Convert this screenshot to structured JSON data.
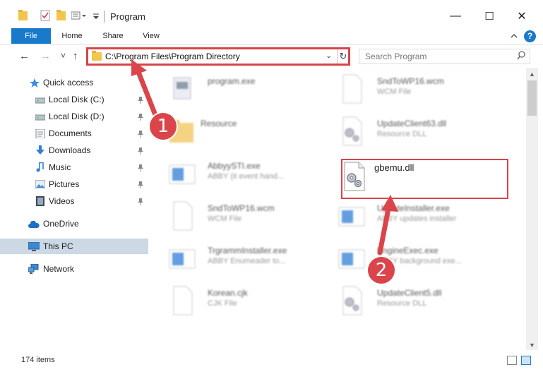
{
  "window": {
    "title": "Program",
    "minimize": "—",
    "maximize": "☐",
    "close": "✕"
  },
  "ribbon": {
    "tabs": [
      "File",
      "Home",
      "Share",
      "View"
    ],
    "help": "?"
  },
  "address": {
    "path": "C:\\Program Files\\Program Directory",
    "dropdown": "⌄",
    "refresh": "↻"
  },
  "search": {
    "placeholder": "Search Program",
    "icon": "search-icon"
  },
  "nav": {
    "back": "←",
    "forward": "→",
    "recent": "˅",
    "up": "↑",
    "items": [
      {
        "label": "Quick access",
        "icon": "star-icon",
        "pinned": false
      },
      {
        "label": "Local Disk (C:)",
        "icon": "drive-icon",
        "pinned": true
      },
      {
        "label": "Local Disk (D:)",
        "icon": "drive-icon",
        "pinned": true
      },
      {
        "label": "Documents",
        "icon": "documents-icon",
        "pinned": true
      },
      {
        "label": "Downloads",
        "icon": "download-icon",
        "pinned": true
      },
      {
        "label": "Music",
        "icon": "music-icon",
        "pinned": true
      },
      {
        "label": "Pictures",
        "icon": "pictures-icon",
        "pinned": true
      },
      {
        "label": "Videos",
        "icon": "videos-icon",
        "pinned": true
      },
      {
        "label": "OneDrive",
        "icon": "cloud-icon",
        "pinned": false
      },
      {
        "label": "This PC",
        "icon": "computer-icon",
        "pinned": false,
        "selected": true
      },
      {
        "label": "Network",
        "icon": "network-icon",
        "pinned": false
      }
    ]
  },
  "files": {
    "left": [
      {
        "name": "program.exe",
        "type": "",
        "icon": "exe-icon"
      },
      {
        "name": "Resource",
        "type": "",
        "icon": "folder-icon"
      },
      {
        "name": "AbbyySTI.exe",
        "type": "ABBY (it event hand...",
        "icon": "app-icon"
      },
      {
        "name": "SndToWP16.wcm",
        "type": "WCM File",
        "icon": "file-icon"
      },
      {
        "name": "TrgrammInstaller.exe",
        "type": "ABBY Enumeader to...",
        "icon": "app-icon"
      },
      {
        "name": "Korean.cjk",
        "type": "CJK File",
        "icon": "file-icon"
      }
    ],
    "right": [
      {
        "name": "SndToWP16.wcm",
        "type": "WCM File",
        "icon": "file-icon"
      },
      {
        "name": "UpdateClient63.dll",
        "type": "Resource DLL",
        "icon": "dll-icon"
      },
      {
        "name": "gbemu.dll",
        "type": "",
        "icon": "dll-icon",
        "highlighted": true
      },
      {
        "name": "UpdateInstaller.exe",
        "type": "ABBY updates installer",
        "icon": "app-icon"
      },
      {
        "name": "EngineExec.exe",
        "type": "ABBY background exe...",
        "icon": "app-icon"
      },
      {
        "name": "UpdateClient5.dll",
        "type": "Resource DLL",
        "icon": "dll-icon"
      }
    ]
  },
  "status": {
    "count": "174 items"
  },
  "annotations": {
    "badge1": "1",
    "badge2": "2"
  },
  "colors": {
    "accent": "#1979ca",
    "annotation": "#d8444a",
    "selected": "#ccd8e4"
  }
}
